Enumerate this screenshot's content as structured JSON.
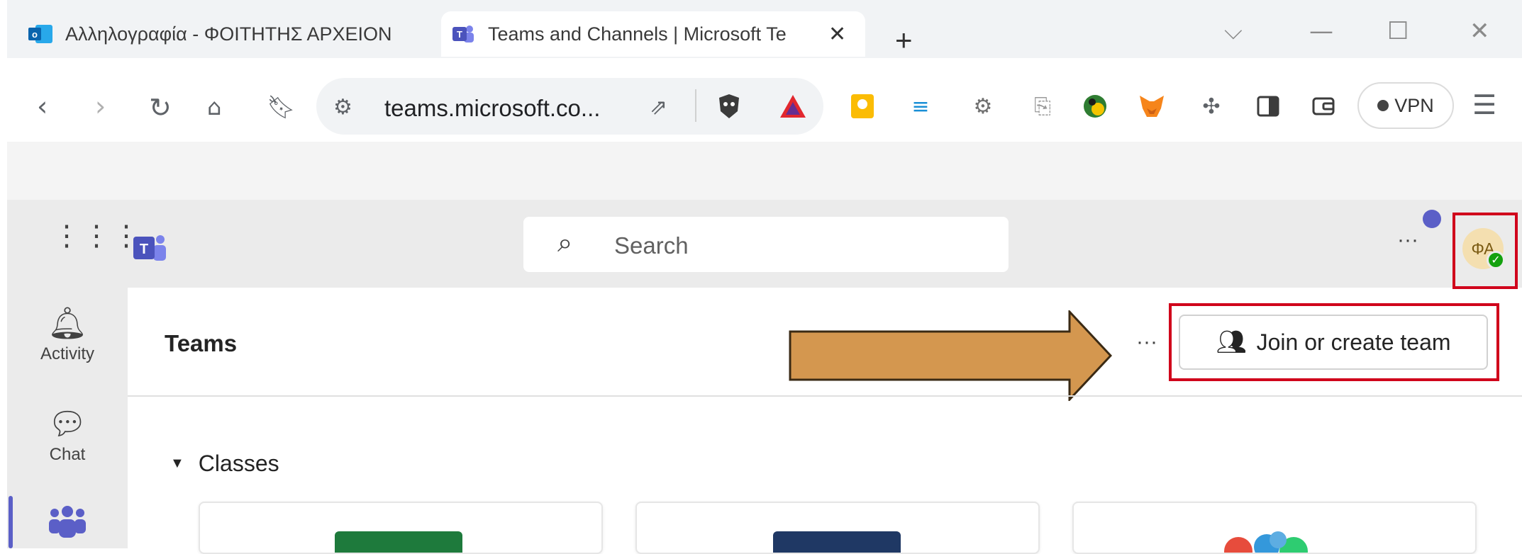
{
  "browser": {
    "tabs": [
      {
        "label": "Αλληλογραφία - ΦΟΙΤΗΤΗΣ ΑΡΧΕΙΟΝ",
        "favicon": "outlook-icon",
        "active": false
      },
      {
        "label": "Teams and Channels | Microsoft Te",
        "favicon": "teams-icon",
        "active": true
      }
    ],
    "tab_close": "✕",
    "new_tab": "+",
    "url": "teams.microsoft.co...",
    "vpn_label": "VPN"
  },
  "teams_header": {
    "search_placeholder": "Search",
    "more": "···",
    "avatar_initials": "ΦΑ"
  },
  "rail": {
    "items": [
      {
        "label": "Activity",
        "icon": "bell-icon"
      },
      {
        "label": "Chat",
        "icon": "chat-icon"
      },
      {
        "label": "",
        "icon": "teams-people-icon"
      }
    ]
  },
  "main": {
    "title": "Teams",
    "more": "···",
    "join_button": "Join or create team",
    "section": "Classes"
  },
  "colors": {
    "accent": "#5b5fc7",
    "highlight_box": "#d0021b",
    "arrow_fill": "#d4974f",
    "presence": "#13a10e"
  }
}
